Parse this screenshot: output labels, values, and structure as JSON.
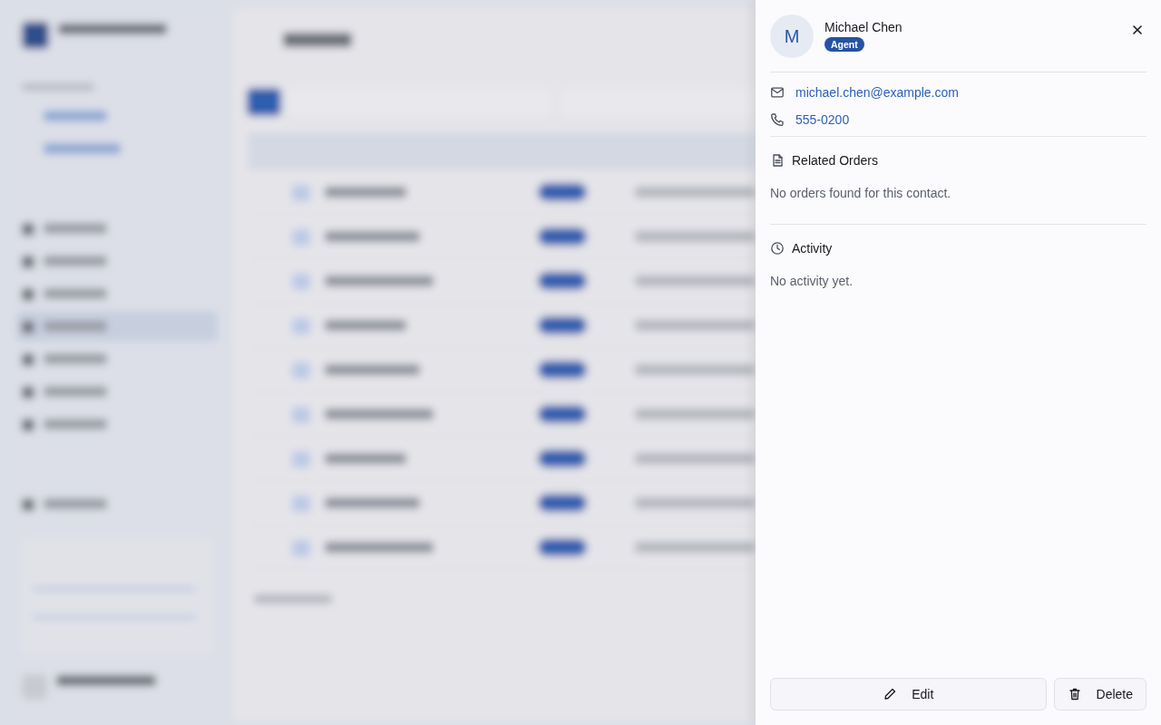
{
  "contact": {
    "initial": "M",
    "name": "Michael Chen",
    "type": "Agent",
    "email": "michael.chen@example.com",
    "phone": "555-0200"
  },
  "sections": [
    {
      "kind": "orders",
      "title": "Related Orders",
      "empty_text": "No orders found for this contact."
    },
    {
      "kind": "activity",
      "title": "Activity",
      "empty_text": "No activity yet."
    }
  ],
  "actions": [
    {
      "kind": "edit",
      "label": "Edit"
    },
    {
      "kind": "delete",
      "label": "Delete"
    }
  ]
}
